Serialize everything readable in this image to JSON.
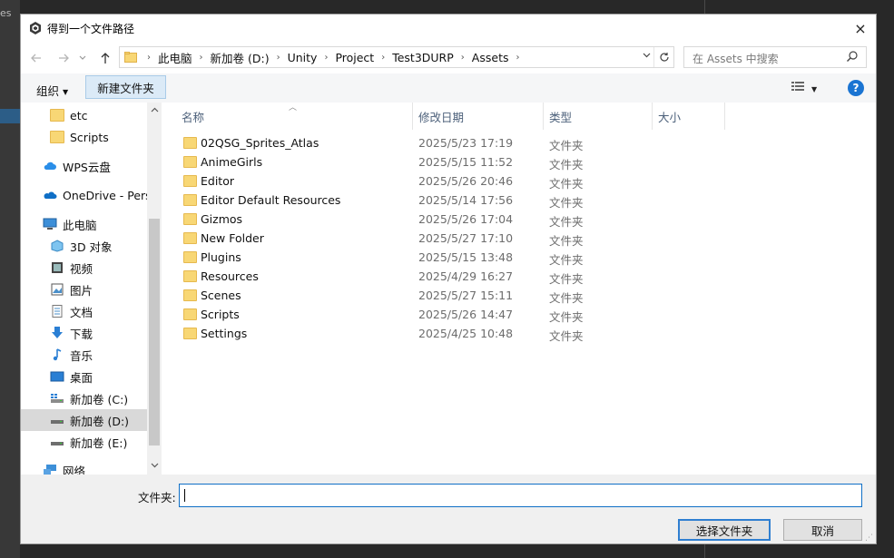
{
  "background": {
    "left_text": "es"
  },
  "dialog": {
    "title": "得到一个文件路径",
    "close_icon": "×"
  },
  "address": {
    "crumbs": [
      "此电脑",
      "新加卷 (D:)",
      "Unity",
      "Project",
      "Test3DURP",
      "Assets"
    ]
  },
  "search": {
    "placeholder": "在 Assets 中搜索"
  },
  "toolbar": {
    "organize_label": "组织",
    "new_folder_label": "新建文件夹",
    "help_label": "?"
  },
  "nav": {
    "items": [
      {
        "label": "etc",
        "icon": "folder-icon"
      },
      {
        "label": "Scripts",
        "icon": "folder-icon"
      },
      {
        "label": "WPS云盘",
        "icon": "cloud-icon"
      },
      {
        "label": "OneDrive - Perso",
        "icon": "onedrive-icon"
      },
      {
        "label": "此电脑",
        "icon": "computer-icon"
      },
      {
        "label": "3D 对象",
        "icon": "3d-objects-icon"
      },
      {
        "label": "视频",
        "icon": "video-icon"
      },
      {
        "label": "图片",
        "icon": "pictures-icon"
      },
      {
        "label": "文档",
        "icon": "documents-icon"
      },
      {
        "label": "下载",
        "icon": "download-icon"
      },
      {
        "label": "音乐",
        "icon": "music-icon"
      },
      {
        "label": "桌面",
        "icon": "desktop-icon"
      },
      {
        "label": "新加卷 (C:)",
        "icon": "drive-icon"
      },
      {
        "label": "新加卷 (D:)",
        "icon": "drive-icon"
      },
      {
        "label": "新加卷 (E:)",
        "icon": "drive-icon"
      },
      {
        "label": "网络",
        "icon": "network-icon"
      }
    ]
  },
  "columns": {
    "name": "名称",
    "modified": "修改日期",
    "type": "类型",
    "size": "大小"
  },
  "files": [
    {
      "name": "02QSG_Sprites_Atlas",
      "modified": "2025/5/23 17:19",
      "type": "文件夹"
    },
    {
      "name": "AnimeGirls",
      "modified": "2025/5/15 11:52",
      "type": "文件夹"
    },
    {
      "name": "Editor",
      "modified": "2025/5/26 20:46",
      "type": "文件夹"
    },
    {
      "name": "Editor Default Resources",
      "modified": "2025/5/14 17:56",
      "type": "文件夹"
    },
    {
      "name": "Gizmos",
      "modified": "2025/5/26 17:04",
      "type": "文件夹"
    },
    {
      "name": "New Folder",
      "modified": "2025/5/27 17:10",
      "type": "文件夹"
    },
    {
      "name": "Plugins",
      "modified": "2025/5/15 13:48",
      "type": "文件夹"
    },
    {
      "name": "Resources",
      "modified": "2025/4/29 16:27",
      "type": "文件夹"
    },
    {
      "name": "Scenes",
      "modified": "2025/5/27 15:11",
      "type": "文件夹"
    },
    {
      "name": "Scripts",
      "modified": "2025/5/26 14:47",
      "type": "文件夹"
    },
    {
      "name": "Settings",
      "modified": "2025/4/25 10:48",
      "type": "文件夹"
    }
  ],
  "footer": {
    "filename_label": "文件夹:",
    "filename_value": "",
    "ok_label": "选择文件夹",
    "cancel_label": "取消"
  },
  "colors": {
    "accent": "#0f6fc6",
    "folder": "#f8d775",
    "selection": "#d9d9d9",
    "help": "#1a74d2"
  }
}
